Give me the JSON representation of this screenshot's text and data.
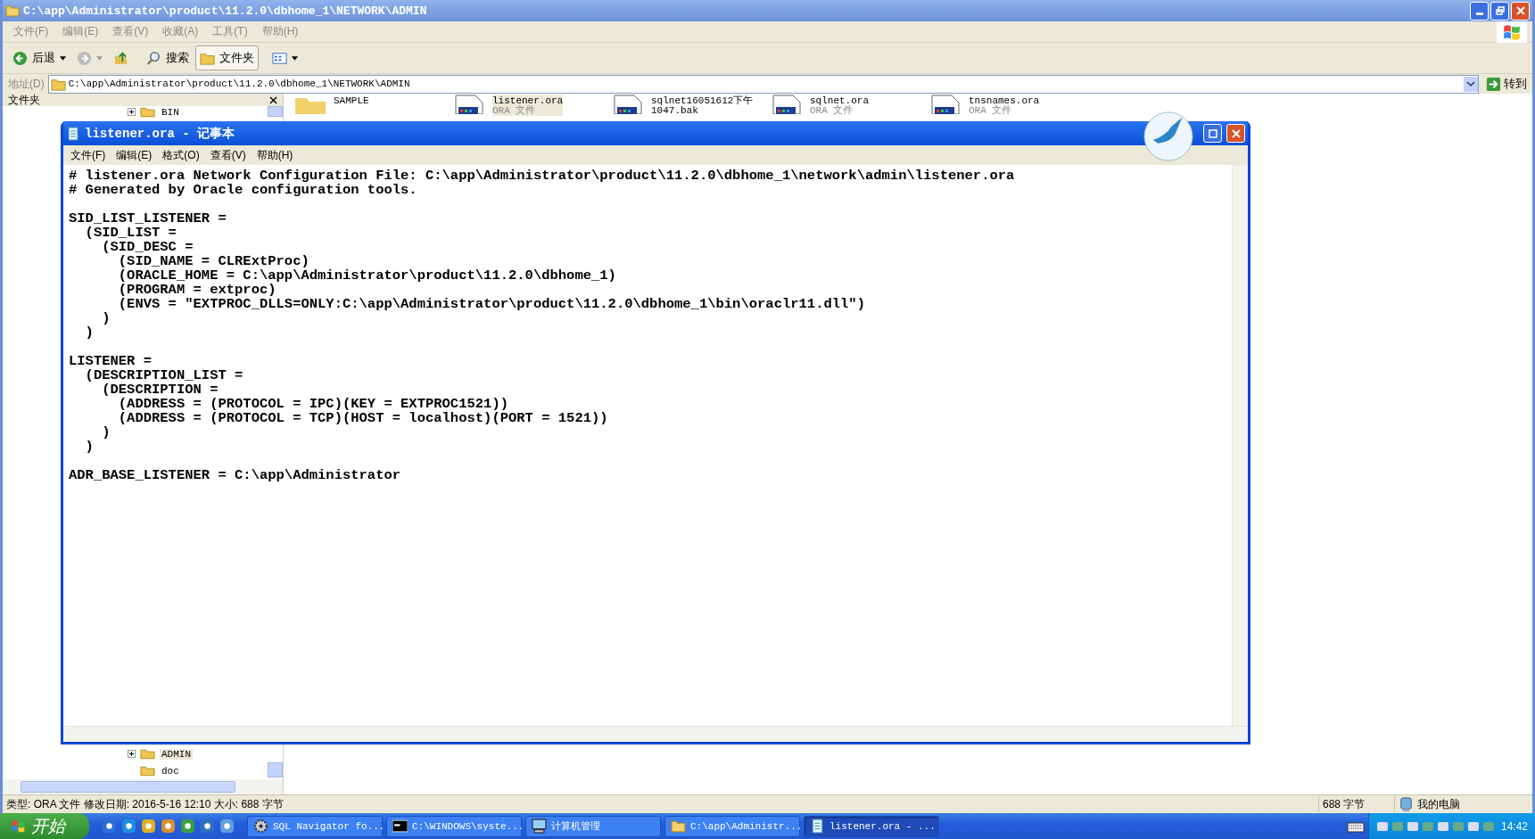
{
  "explorer": {
    "title": "C:\\app\\Administrator\\product\\11.2.0\\dbhome_1\\NETWORK\\ADMIN",
    "menu": [
      "文件(F)",
      "编辑(E)",
      "查看(V)",
      "收藏(A)",
      "工具(T)",
      "帮助(H)"
    ],
    "toolbar": [
      {
        "kind": "back",
        "label": "后退"
      },
      {
        "kind": "forward"
      },
      {
        "kind": "up"
      },
      {
        "kind": "search",
        "label": "搜索",
        "selected": false
      },
      {
        "kind": "folders",
        "label": "文件夹",
        "selected": true
      },
      {
        "kind": "views"
      }
    ],
    "address": {
      "label": "地址(D)",
      "value": "C:\\app\\Administrator\\product\\11.2.0\\dbhome_1\\NETWORK\\ADMIN",
      "go": "转到"
    },
    "folder_pane": {
      "title": "文件夹",
      "tree_top": [
        {
          "label": "BIN",
          "selected": false
        }
      ],
      "tree_bottom": [
        {
          "label": "ADMIN",
          "selected": true,
          "expandable": true
        },
        {
          "label": "doc",
          "selected": false,
          "expandable": false
        }
      ]
    },
    "files": [
      {
        "kind": "folder",
        "name": "SAMPLE",
        "selected": false
      },
      {
        "kind": "document",
        "name": "listener.ora",
        "type": "ORA 文件",
        "selected": true
      },
      {
        "kind": "document",
        "name": "sqlnet16051612下午",
        "type": "1047.bak",
        "selected": false
      },
      {
        "kind": "document",
        "name": "sqlnet.ora",
        "type": "ORA 文件",
        "selected": false
      },
      {
        "kind": "document",
        "name": "tnsnames.ora",
        "type": "ORA 文件",
        "selected": false
      }
    ],
    "status_bar": {
      "details": "类型: ORA 文件 修改日期: 2016-5-16 12:10 大小: 688 字节",
      "size": "688 字节",
      "zone": "我的电脑"
    }
  },
  "notepad": {
    "title": "listener.ora - 记事本",
    "menu": [
      "文件(F)",
      "编辑(E)",
      "格式(O)",
      "查看(V)",
      "帮助(H)"
    ],
    "text": "# listener.ora Network Configuration File: C:\\app\\Administrator\\product\\11.2.0\\dbhome_1\\network\\admin\\listener.ora\n# Generated by Oracle configuration tools.\n\nSID_LIST_LISTENER =\n  (SID_LIST =\n    (SID_DESC =\n      (SID_NAME = CLRExtProc)\n      (ORACLE_HOME = C:\\app\\Administrator\\product\\11.2.0\\dbhome_1)\n      (PROGRAM = extproc)\n      (ENVS = \"EXTPROC_DLLS=ONLY:C:\\app\\Administrator\\product\\11.2.0\\dbhome_1\\bin\\oraclr11.dll\")\n    )\n  )\n\nLISTENER =\n  (DESCRIPTION_LIST =\n    (DESCRIPTION =\n      (ADDRESS = (PROTOCOL = IPC)(KEY = EXTPROC1521))\n      (ADDRESS = (PROTOCOL = TCP)(HOST = localhost)(PORT = 1521))\n    )\n  )\n\nADR_BASE_LISTENER = C:\\app\\Administrator"
  },
  "taskbar": {
    "start": "开始",
    "tasks": [
      {
        "kind": "gear",
        "label": "SQL Navigator fo...",
        "selected": false
      },
      {
        "kind": "console",
        "label": "C:\\WINDOWS\\syste...",
        "selected": false
      },
      {
        "kind": "computer",
        "label": "计算机管理",
        "selected": false
      },
      {
        "kind": "folder",
        "label": "C:\\app\\Administr...",
        "selected": false
      },
      {
        "kind": "notepad",
        "label": "listener.ora - ...",
        "selected": true
      }
    ],
    "clock": "14:42"
  }
}
